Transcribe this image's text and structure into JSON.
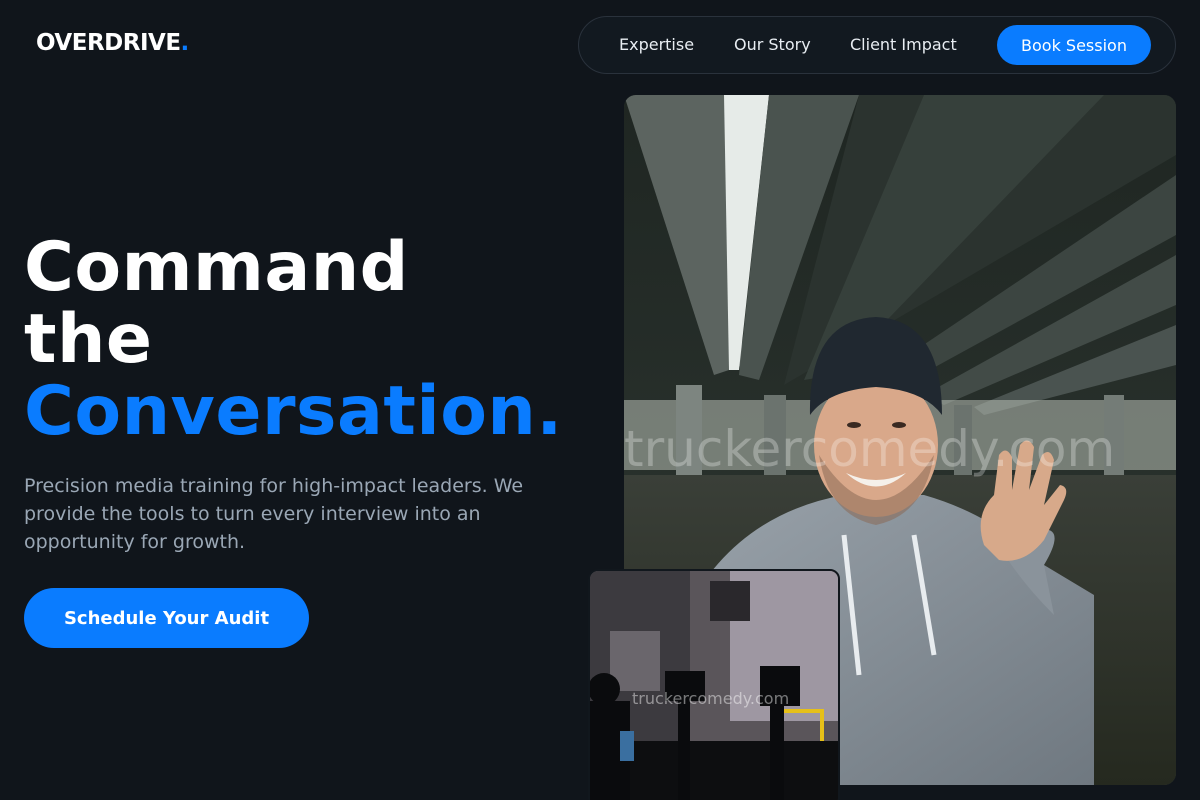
{
  "brand": {
    "name": "OVERDRIVE",
    "dot": "."
  },
  "nav": {
    "links": [
      "Expertise",
      "Our Story",
      "Client Impact"
    ],
    "cta": "Book Session"
  },
  "hero": {
    "headline_line1": "Command",
    "headline_line2": "the",
    "headline_accent": "Conversation.",
    "subtext": "Precision media training for high-impact leaders. We provide the tools to turn every interview into an opportunity for growth.",
    "cta": "Schedule Your Audit"
  },
  "images": {
    "main_watermark": "truckercomedy.com",
    "secondary_watermark": "truckercomedy.com"
  },
  "colors": {
    "background": "#10151b",
    "accent": "#0a7cff",
    "text": "#ffffff",
    "muted": "#9aa7b5"
  }
}
